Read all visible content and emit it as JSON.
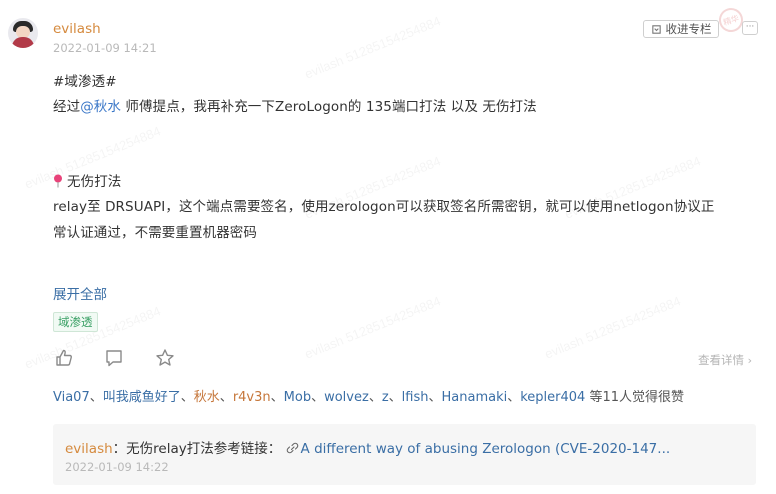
{
  "post": {
    "author": "evilash",
    "datetime": "2022-01-09 14:21",
    "collect_label": "收进专栏",
    "stamp_text": "精华",
    "more_label": "···",
    "line1": "#域渗透#",
    "line2_pre": "经过",
    "line2_mention": "@秋水",
    "line2_post": " 师傅提点，我再补充一下ZeroLogon的 135端口打法 以及 无伤打法",
    "section_title": "无伤打法",
    "body_line1": "relay至 DRSUAPI，这个端点需要签名，使用zerologon可以获取签名所需密钥，就可以使用netlogon协议正",
    "body_line2": "常认证通过，不需要重置机器密码",
    "expand_label": "展开全部",
    "tag": "域渗透"
  },
  "actions": {
    "like_icon": "thumbs-up-icon",
    "comment_icon": "comment-icon",
    "star_icon": "star-icon",
    "detail_label": "查看详情"
  },
  "likes": {
    "users_before": [
      "Via07",
      "叫我咸鱼好了"
    ],
    "special_user": "秋水",
    "users_after": [
      "r4v3n",
      "Mob",
      "wolvez",
      "z",
      "lfish",
      "Hanamaki",
      "kepler404"
    ],
    "count_text": "等11人觉得很赞",
    "separator": "、"
  },
  "reply": {
    "author": "evilash",
    "colon": "：",
    "text": "无伤relay打法参考链接：",
    "link_text": "A different way of abusing Zerologon (CVE-2020-147...",
    "time": "2022-01-09 14:22"
  },
  "watermark_text": "evilash 51285154254884",
  "colors": {
    "author": "#d58a3e",
    "link": "#3a6ea5",
    "mention": "#3a77c8",
    "tag_green": "#3aa065",
    "pin": "#e8437a"
  }
}
